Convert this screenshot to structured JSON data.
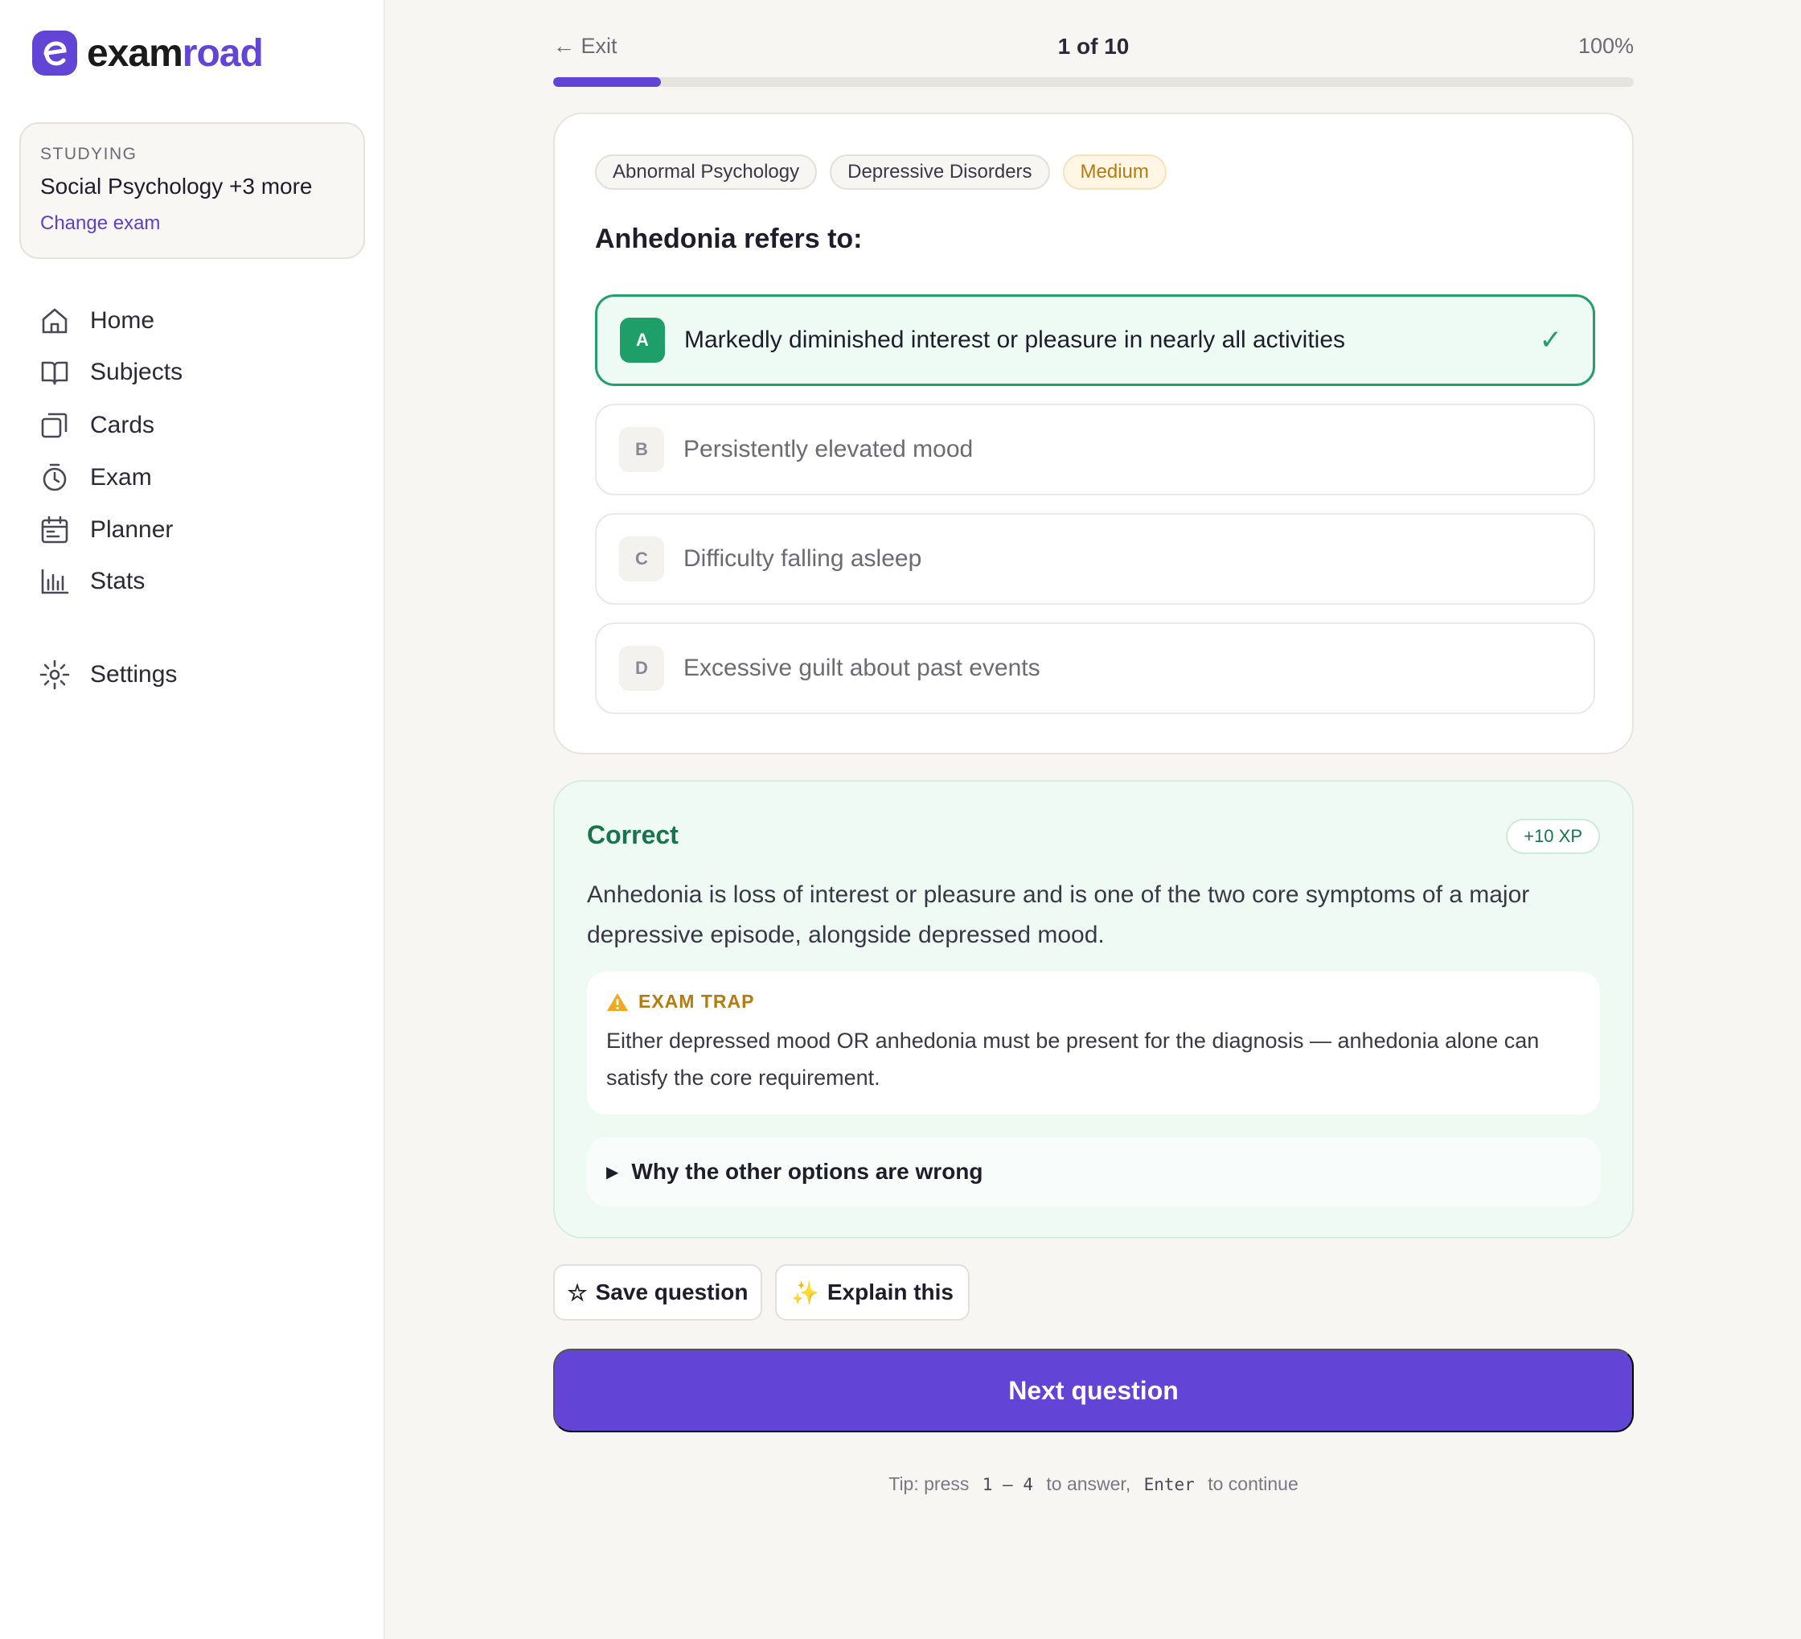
{
  "brand": {
    "part1": "exam",
    "part2": "road"
  },
  "studying": {
    "kicker": "STUDYING",
    "title": "Social Psychology +3 more",
    "link": "Change exam"
  },
  "nav": [
    {
      "label": "Home",
      "icon": "home-icon"
    },
    {
      "label": "Subjects",
      "icon": "book-icon"
    },
    {
      "label": "Cards",
      "icon": "cards-icon"
    },
    {
      "label": "Exam",
      "icon": "timer-icon"
    },
    {
      "label": "Planner",
      "icon": "calendar-icon"
    },
    {
      "label": "Stats",
      "icon": "bar-chart-icon"
    },
    {
      "label": "Settings",
      "icon": "gear-icon"
    }
  ],
  "topbar": {
    "exit": "← Exit",
    "counter": "1 of 10",
    "percent": "100%",
    "progress": 0.1
  },
  "question": {
    "tags": [
      "Abnormal Psychology",
      "Depressive Disorders",
      "Medium"
    ],
    "title": "Anhedonia refers to:",
    "options": [
      {
        "letter": "A",
        "text": "Markedly diminished interest or pleasure in nearly all activities",
        "correct": true
      },
      {
        "letter": "B",
        "text": "Persistently elevated mood"
      },
      {
        "letter": "C",
        "text": "Difficulty falling asleep"
      },
      {
        "letter": "D",
        "text": "Excessive guilt about past events"
      }
    ],
    "check_mark": "✓"
  },
  "feedback": {
    "title": "Correct",
    "xp": "+10 XP",
    "text": "Anhedonia is loss of interest or pleasure and is one of the two core symptoms of a major depressive episode, alongside depressed mood.",
    "trap_label": "EXAM TRAP",
    "trap_text": "Either depressed mood OR anhedonia must be present for the diagnosis — anhedonia alone can satisfy the core requirement.",
    "why_label": "Why the other options are wrong"
  },
  "actions": {
    "save": "Save question",
    "save_icon": "☆",
    "explain": "Explain this",
    "explain_icon": "✨"
  },
  "next_label": "Next question",
  "tip": {
    "a": "Tip: press",
    "k1": "1 – 4",
    "b": "to answer,",
    "k2": "Enter",
    "c": "to continue"
  },
  "colors": {
    "accent": "#6244d6",
    "success": "#1e9e68",
    "warning": "#b57b0e"
  }
}
